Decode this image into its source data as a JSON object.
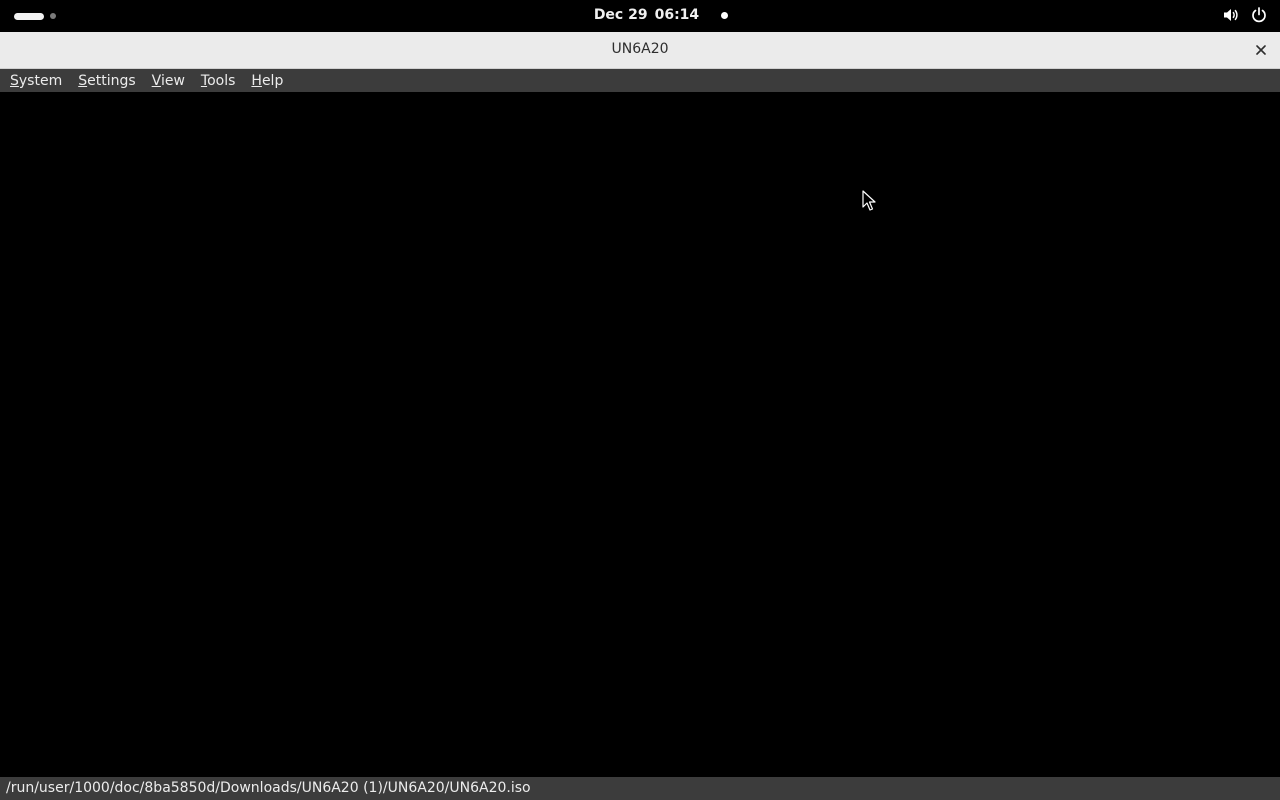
{
  "top_bar": {
    "date": "Dec 29",
    "time": "06:14",
    "tray_icons": [
      "volume-icon",
      "power-icon"
    ]
  },
  "window": {
    "title": "UN6A20",
    "close_icon": "close-icon"
  },
  "menubar": {
    "items": [
      {
        "label": "System",
        "mnemonic": "S",
        "rest": "ystem"
      },
      {
        "label": "Settings",
        "mnemonic": "S",
        "rest": "ettings"
      },
      {
        "label": "View",
        "mnemonic": "V",
        "rest": "iew"
      },
      {
        "label": "Tools",
        "mnemonic": "T",
        "rest": "ools"
      },
      {
        "label": "Help",
        "mnemonic": "H",
        "rest": "elp"
      }
    ]
  },
  "status_bar": {
    "path": "/run/user/1000/doc/8ba5850d/Downloads/UN6A20 (1)/UN6A20/UN6A20.iso"
  },
  "colors": {
    "top_bar_bg": "#000000",
    "title_bar_bg": "#ebebeb",
    "menu_bar_bg": "#3c3c3c",
    "status_bar_bg": "#3c3c3c",
    "viewport_bg": "#000000"
  }
}
